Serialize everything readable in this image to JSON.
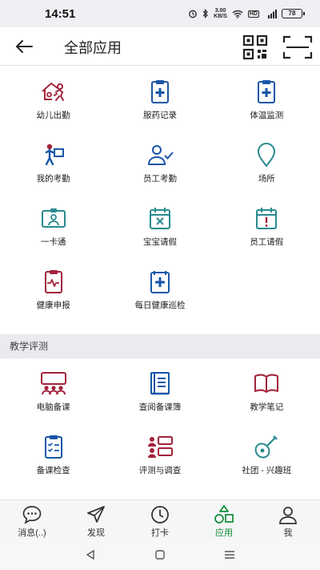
{
  "status": {
    "time": "14:51",
    "net_speed_top": "3.00",
    "net_speed_bottom": "KB/S",
    "hd": "HD",
    "signal": "4G",
    "battery": "78"
  },
  "header": {
    "title": "全部应用"
  },
  "colors": {
    "red": "#a3243b",
    "blue": "#1a56a8",
    "teal": "#2a8a8f",
    "green": "#0f8a35"
  },
  "apps_top": [
    {
      "label": "幼儿出勤",
      "icon": "child-attendance-icon"
    },
    {
      "label": "服药记录",
      "icon": "medicine-record-icon"
    },
    {
      "label": "体温监测",
      "icon": "temperature-monitor-icon"
    },
    {
      "label": "我的考勤",
      "icon": "my-attendance-icon"
    },
    {
      "label": "员工考勤",
      "icon": "staff-attendance-icon"
    },
    {
      "label": "场所",
      "icon": "location-pin-icon"
    },
    {
      "label": "一卡通",
      "icon": "id-card-icon"
    },
    {
      "label": "宝宝请假",
      "icon": "baby-leave-icon"
    },
    {
      "label": "员工请假",
      "icon": "staff-leave-icon"
    },
    {
      "label": "健康申报",
      "icon": "health-report-icon"
    },
    {
      "label": "每日健康巡检",
      "icon": "daily-health-check-icon"
    }
  ],
  "section": {
    "title": "教学评测"
  },
  "apps_teach": [
    {
      "label": "电脑备课",
      "icon": "computer-prep-icon"
    },
    {
      "label": "查阅备课簿",
      "icon": "prep-book-icon"
    },
    {
      "label": "教学笔记",
      "icon": "teaching-notes-icon"
    },
    {
      "label": "备课检查",
      "icon": "prep-check-icon"
    },
    {
      "label": "评测与调查",
      "icon": "evaluation-survey-icon"
    },
    {
      "label": "社团 - 兴趣班",
      "icon": "club-interest-icon"
    }
  ],
  "tabs": [
    {
      "label": "消息(..)",
      "icon": "chat-bubble-icon"
    },
    {
      "label": "发现",
      "icon": "discover-icon"
    },
    {
      "label": "打卡",
      "icon": "clock-icon"
    },
    {
      "label": "应用",
      "icon": "apps-shapes-icon",
      "active": true
    },
    {
      "label": "我",
      "icon": "person-icon"
    }
  ]
}
